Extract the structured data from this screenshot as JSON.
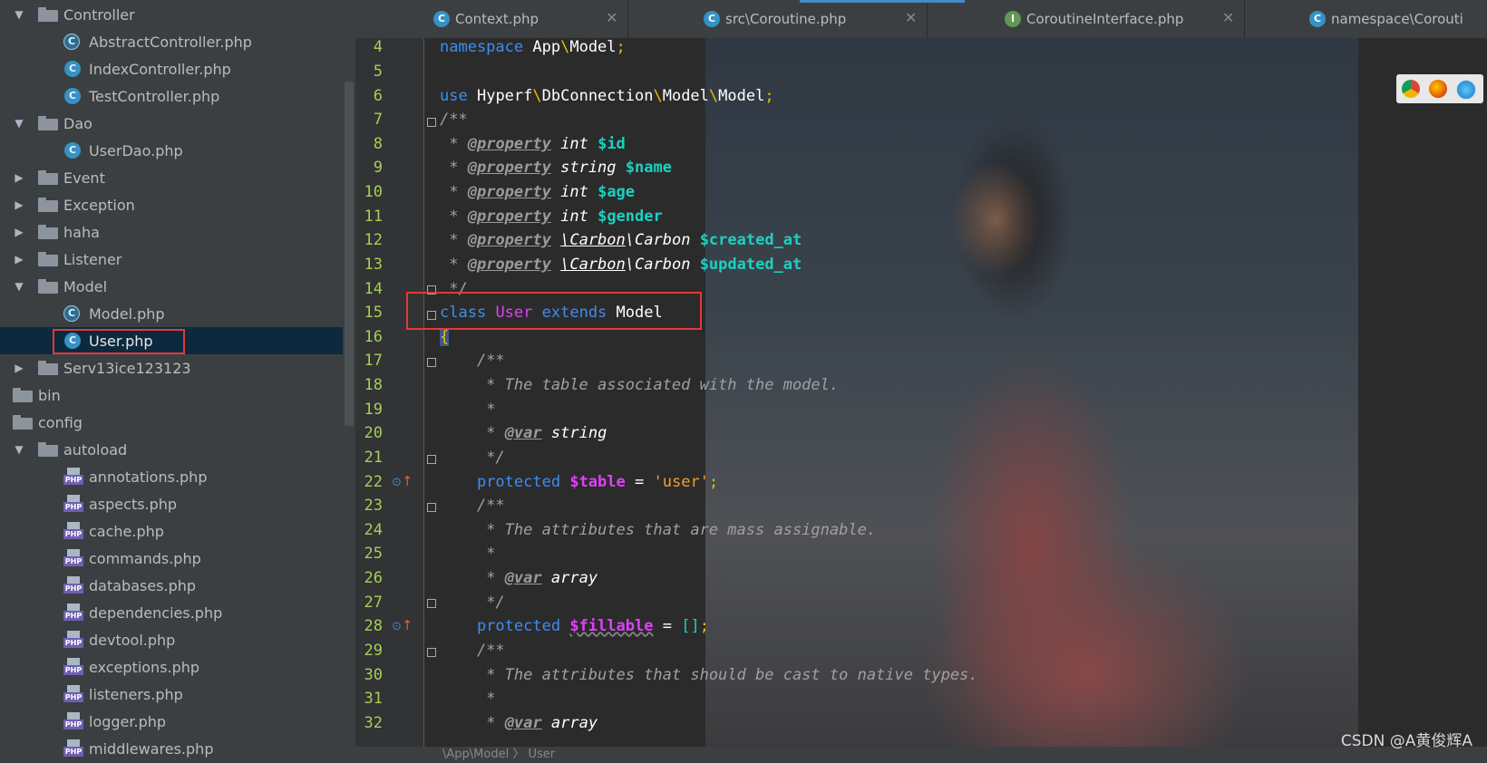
{
  "project_tree": {
    "items": [
      {
        "label": "Controller",
        "kind": "folder",
        "expanded": true
      },
      {
        "label": "AbstractController.php",
        "kind": "abstract-class"
      },
      {
        "label": "IndexController.php",
        "kind": "class"
      },
      {
        "label": "TestController.php",
        "kind": "class"
      },
      {
        "label": "Dao",
        "kind": "folder",
        "expanded": true
      },
      {
        "label": "UserDao.php",
        "kind": "class"
      },
      {
        "label": "Event",
        "kind": "folder",
        "expanded": false
      },
      {
        "label": "Exception",
        "kind": "folder",
        "expanded": false
      },
      {
        "label": "haha",
        "kind": "folder",
        "expanded": false
      },
      {
        "label": "Listener",
        "kind": "folder",
        "expanded": false
      },
      {
        "label": "Model",
        "kind": "folder",
        "expanded": true
      },
      {
        "label": "Model.php",
        "kind": "abstract-class"
      },
      {
        "label": "User.php",
        "kind": "class",
        "selected": true
      },
      {
        "label": "Serv13ice123123",
        "kind": "folder",
        "expanded": false
      },
      {
        "label": "bin",
        "kind": "folder"
      },
      {
        "label": "config",
        "kind": "folder"
      },
      {
        "label": "autoload",
        "kind": "folder",
        "expanded": true
      },
      {
        "label": "annotations.php",
        "kind": "php"
      },
      {
        "label": "aspects.php",
        "kind": "php"
      },
      {
        "label": "cache.php",
        "kind": "php"
      },
      {
        "label": "commands.php",
        "kind": "php"
      },
      {
        "label": "databases.php",
        "kind": "php"
      },
      {
        "label": "dependencies.php",
        "kind": "php"
      },
      {
        "label": "devtool.php",
        "kind": "php"
      },
      {
        "label": "exceptions.php",
        "kind": "php"
      },
      {
        "label": "listeners.php",
        "kind": "php"
      },
      {
        "label": "logger.php",
        "kind": "php"
      },
      {
        "label": "middlewares.php",
        "kind": "php"
      }
    ],
    "icon_letters": {
      "class": "C",
      "interface": "I",
      "php": "PHP"
    }
  },
  "tabs": [
    {
      "label": "Context.php",
      "icon": "C"
    },
    {
      "label": "src\\Coroutine.php",
      "icon": "C"
    },
    {
      "label": "CoroutineInterface.php",
      "icon": "I"
    },
    {
      "label": "namespace\\Corouti",
      "icon": "C"
    }
  ],
  "close_glyph": "✕",
  "editor": {
    "line_numbers": [
      "4",
      "5",
      "6",
      "7",
      "8",
      "9",
      "10",
      "11",
      "12",
      "13",
      "14",
      "15",
      "16",
      "17",
      "18",
      "19",
      "20",
      "21",
      "22",
      "23",
      "24",
      "25",
      "26",
      "27",
      "28",
      "29",
      "30",
      "31",
      "32"
    ],
    "tokens": {
      "namespace": "namespace",
      "app_model": "App",
      "bs": "\\",
      "model_word": "Model",
      "semi": ";",
      "use": "use",
      "hyperf": "Hyperf",
      "dbconn": "DbConnection",
      "doc_open": "/**",
      "star": " *",
      "doc_close": " */",
      "property": "@property",
      "int": "int",
      "string": "string",
      "carbon_ns": "\\Carbon",
      "carbon": "Carbon",
      "v_id": "$id",
      "v_name": "$name",
      "v_age": "$age",
      "v_gender": "$gender",
      "v_created": "$created_at",
      "v_updated": "$updated_at",
      "class": "class",
      "user": "User",
      "extends": "extends",
      "brace": "{",
      "c_table": " * The table associated with the model.",
      "var_tag": "@var",
      "array": "array",
      "protected": "protected",
      "v_table": "$table",
      "eq": "=",
      "s_user": "'user'",
      "c_fill": " * The attributes that are mass assignable.",
      "v_fillable": "$fillable",
      "arr": "[]",
      "c_cast": " * The attributes that should be cast to native types."
    }
  },
  "statusbar": {
    "breadcrumb_ns": "\\App\\Model",
    "breadcrumb_sep": "〉",
    "breadcrumb_class": "User"
  },
  "watermark": "CSDN @A黄俊辉A",
  "colors": {
    "selection_box": "#e53935",
    "keyword": "#3f8df0",
    "variable": "#1bd1c1"
  }
}
